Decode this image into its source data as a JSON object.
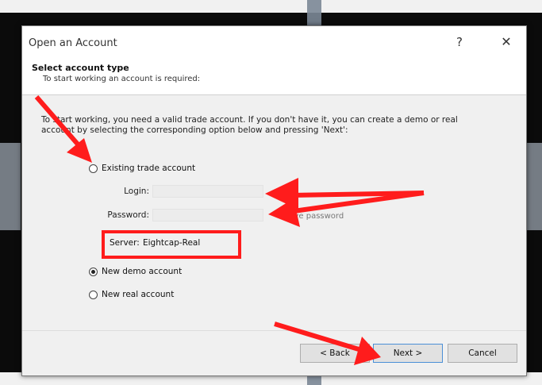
{
  "dialog": {
    "title": "Open an Account",
    "help_icon": "?",
    "close_icon": "✕",
    "header_title": "Select account type",
    "header_subtitle": "To start working an account is required:",
    "description": "To start working, you need a valid trade account. If you don't have it, you can create a demo or real account by selecting the corresponding option below and pressing 'Next':",
    "options": {
      "existing": "Existing trade account",
      "demo": "New demo account",
      "real": "New real account"
    },
    "selected_option": "demo",
    "login_label": "Login:",
    "password_label": "Password:",
    "save_password_label": "Save password",
    "server_label": "Server:",
    "server_value": "Eightcap-Real",
    "buttons": {
      "back": "< Back",
      "next": "Next >",
      "cancel": "Cancel"
    }
  },
  "annotation_color": "#ff1c1c"
}
